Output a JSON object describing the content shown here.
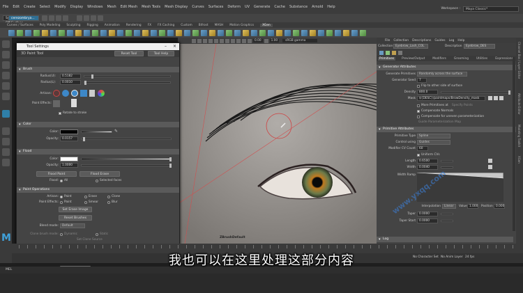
{
  "menubar": {
    "items": [
      "File",
      "Edit",
      "Create",
      "Select",
      "Modify",
      "Display",
      "Windows",
      "Mesh",
      "Edit Mesh",
      "Mesh Tools",
      "Mesh Display",
      "Curves",
      "Surfaces",
      "Deform",
      "UV",
      "Generate",
      "Cache",
      "Substance",
      "Arnold",
      "Help"
    ],
    "workspace_label": "Workspace :",
    "workspace_value": "Maya Classic*"
  },
  "statusline": {
    "mode": "Modeling",
    "surface": "No Live Surface",
    "symmetry": "Symmetry: Off",
    "user": "cerezombrya..."
  },
  "shelf_tabs": [
    "Curves / Surfaces",
    "Poly Modeling",
    "Sculpting",
    "Rigging",
    "Animation",
    "Rendering",
    "FX",
    "FX Caching",
    "Custom",
    "Bifrost",
    "MASH",
    "Motion Graphics",
    "XGen"
  ],
  "shelf_active": "XGen",
  "viewport": {
    "menu_values": [
      "0.00",
      "1.00"
    ],
    "color_space": "sRGB gamma",
    "label": "ZBrushDefault"
  },
  "tool_window": {
    "title": "Tool Settings",
    "tool_name": "3D Paint Tool",
    "reset_label": "Reset Tool",
    "help_label": "Tool Help",
    "brush": {
      "header": "Brush",
      "radius_u_label": "Radius(U):",
      "radius_u": "0.5182",
      "radius_l_label": "Radius(L):",
      "radius_l": "0.0010",
      "artisan_label": "Artisan:",
      "paint_effects_label": "Paint Effects:",
      "rotate_label": "Rotate to stroke"
    },
    "color": {
      "header": "Color",
      "color_label": "Color:",
      "opacity_label": "Opacity:",
      "opacity": "0.0157"
    },
    "flood": {
      "header": "Flood",
      "color_label": "Color:",
      "opacity_label": "Opacity:",
      "opacity": "1.0000",
      "flood_paint": "Flood Paint",
      "flood_erase": "Flood Erase",
      "flood_label": "Flood:",
      "all_label": "All",
      "selected_label": "Selected faces"
    },
    "paint_ops": {
      "header": "Paint Operations",
      "artisan_label": "Artisan:",
      "paint": "Paint",
      "erase": "Erase",
      "clone": "Clone",
      "pe_label": "Paint Effects:",
      "smear": "Smear",
      "blur": "Blur",
      "set_erase": "Set Erase Image",
      "reset_brushes": "Reset Brushes",
      "blend_label": "Blend mode:",
      "blend_value": "Default",
      "clone_mode_label": "Clone brush mode:",
      "dynamic": "Dynamic",
      "static": "Static",
      "set_clone": "Set Clone Source",
      "blur_label": "Blur intensity:",
      "blur_value": "10"
    },
    "file_textures": {
      "header": "File Textures",
      "attr_label": "Attribute to paint:",
      "attr_value": "Eyebrow_Lash_COL_Eyebrow_DES_BrowDensity_mask",
      "assign": "Assign/Edit Textures"
    }
  },
  "right_panel": {
    "menu": [
      "File",
      "Collection",
      "Descriptions",
      "Guides",
      "Log",
      "Help"
    ],
    "collection_label": "Collection",
    "collection_value": "Eyebrow_Lash_COL",
    "description_label": "Description",
    "description_value": "Eyebrow_DES",
    "tabs": [
      "Primitives",
      "Preview/Output",
      "Modifiers",
      "Grooming",
      "Utilities",
      "Expressions"
    ],
    "gen_attr_header": "Generator Attributes",
    "gen_primitives_label": "Generate Primitives",
    "gen_primitives_value": "Randomly across the surface",
    "gen_seed_label": "Generator Seed",
    "gen_seed_value": "7",
    "flip_label": "Flip to other side of surface",
    "density_label": "Density",
    "density_value": "800.0",
    "mask_label": "Mask",
    "mask_value": "${DESC}/paintmaps/BrowDensity_mask",
    "more_prims_label": "More Primitives at",
    "specify_points": "Specify Points",
    "compensate_label": "Compensate Normals",
    "compensate_uneven": "Compensate for uneven parameterization",
    "guide_param": "Guide Parameterization Map",
    "prim_attr_header": "Primitive Attributes",
    "prim_type_label": "Primitive Type",
    "prim_type_value": "Spline",
    "control_label": "Control using",
    "control_value": "Guides",
    "cv_label": "Modifier CV Count",
    "cv_value": "60",
    "uniform_label": "Uniform CVs",
    "length_label": "Length",
    "length_value": "0.6500",
    "width_label": "Width",
    "width_value": "0.0040",
    "ramp_label": "Width Ramp",
    "interp_label": "Interpolation",
    "interp_value": "Linear",
    "value_label": "Value",
    "value_value": "1.000",
    "position_label": "Position",
    "position_value": "0.000",
    "taper_label": "Taper",
    "taper_value": "0.0000",
    "taper_start_label": "Taper Start",
    "taper_start_value": "0.0000",
    "log_header": "Log"
  },
  "right_side_tabs": [
    "Channel Box / Layer Editor",
    "Attribute Editor",
    "Modeling Toolkit",
    "XGen"
  ],
  "bottom": {
    "mel_label": "MEL",
    "character_set": "No Character Set",
    "anim_layer": "No Anim Layer",
    "fps": "24 fps"
  },
  "subtitle": "我也可以在这里处理这部分内容",
  "watermark": "www.yxqq.com"
}
